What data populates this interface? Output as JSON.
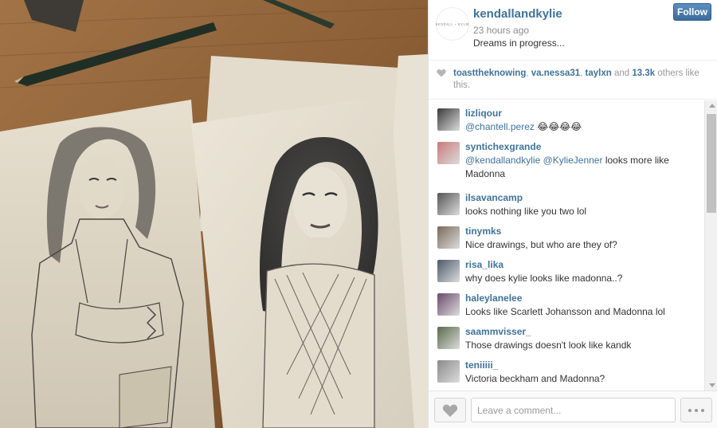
{
  "post": {
    "username": "kendallandkylie",
    "time": "23 hours ago",
    "caption": "Dreams in progress...",
    "avatar_text": "KENDALL + KYLIE",
    "follow_label": "Follow"
  },
  "likes": {
    "users": [
      "toasttheknowing",
      "va.nessa31",
      "taylxn"
    ],
    "sep1": ", ",
    "sep2": ", ",
    "and_text": " and ",
    "count": "13.3k",
    "suffix": " others like this."
  },
  "comments": [
    {
      "user": "lizliqour",
      "text_parts": [
        {
          "t": "@chantell.perez",
          "m": true
        },
        {
          "t": " 😂😂😂😂",
          "m": false
        }
      ],
      "avatar_color": "#3a3a3a"
    },
    {
      "user": "syntichexgrande",
      "text_parts": [
        {
          "t": "@kendallandkylie",
          "m": true
        },
        {
          "t": " ",
          "m": false
        },
        {
          "t": "@KylieJenner",
          "m": true
        },
        {
          "t": " looks more like Madonna",
          "m": false
        }
      ],
      "avatar_color": "#c97a7a"
    },
    {
      "user": "ilsavancamp",
      "text_parts": [
        {
          "t": "looks nothing like you two lol",
          "m": false
        }
      ],
      "avatar_color": "#555"
    },
    {
      "user": "tinymks",
      "text_parts": [
        {
          "t": "Nice drawings, but who are they of?",
          "m": false
        }
      ],
      "avatar_color": "#7b6a5a"
    },
    {
      "user": "risa_lika",
      "text_parts": [
        {
          "t": "why does kylie looks like madonna..?",
          "m": false
        }
      ],
      "avatar_color": "#4a5a6a"
    },
    {
      "user": "haleylanelee",
      "text_parts": [
        {
          "t": "Looks like Scarlett Johansson and Madonna lol",
          "m": false
        }
      ],
      "avatar_color": "#6a4a6a"
    },
    {
      "user": "saammvisser_",
      "text_parts": [
        {
          "t": "Those drawings doesn't look like kandk",
          "m": false
        }
      ],
      "avatar_color": "#5a6a4a"
    },
    {
      "user": "teniiiii_",
      "text_parts": [
        {
          "t": "Victoria beckham and Madonna?",
          "m": false
        }
      ],
      "avatar_color": "#8a8a8a"
    }
  ],
  "footer": {
    "comment_placeholder": "Leave a comment..."
  },
  "colors": {
    "link": "#3f729b",
    "follow_bg": "#3b6c9d"
  },
  "icons": {
    "like": "heart-icon",
    "more": "ellipsis-icon"
  }
}
